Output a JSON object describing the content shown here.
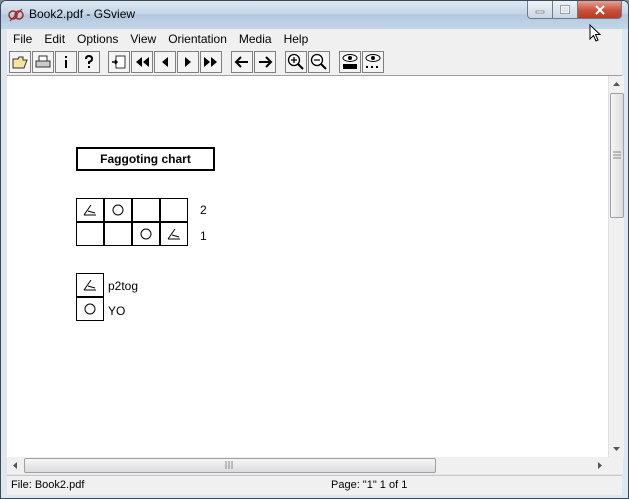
{
  "window": {
    "title": "Book2.pdf - GSview"
  },
  "menu": [
    "File",
    "Edit",
    "Options",
    "View",
    "Orientation",
    "Media",
    "Help"
  ],
  "toolbar_icons": [
    "open-icon",
    "print-icon",
    "info-icon",
    "help-icon",
    "goto-page-icon",
    "first-page-icon",
    "prev-page-icon",
    "next-page-icon",
    "last-page-icon",
    "back-icon",
    "forward-icon",
    "zoom-in-icon",
    "zoom-out-icon",
    "text-find-icon",
    "text-find-next-icon"
  ],
  "document": {
    "chart_title": "Faggoting chart",
    "row_labels": [
      "2",
      "1"
    ],
    "rows": [
      [
        "p2tog",
        "yo",
        "",
        ""
      ],
      [
        "",
        "",
        "yo",
        "p2tog"
      ]
    ],
    "legend": [
      {
        "symbol": "p2tog",
        "label": "p2tog"
      },
      {
        "symbol": "yo",
        "label": "YO"
      }
    ]
  },
  "status": {
    "file": "File: Book2.pdf",
    "page": "Page: \"1\"  1 of 1"
  }
}
